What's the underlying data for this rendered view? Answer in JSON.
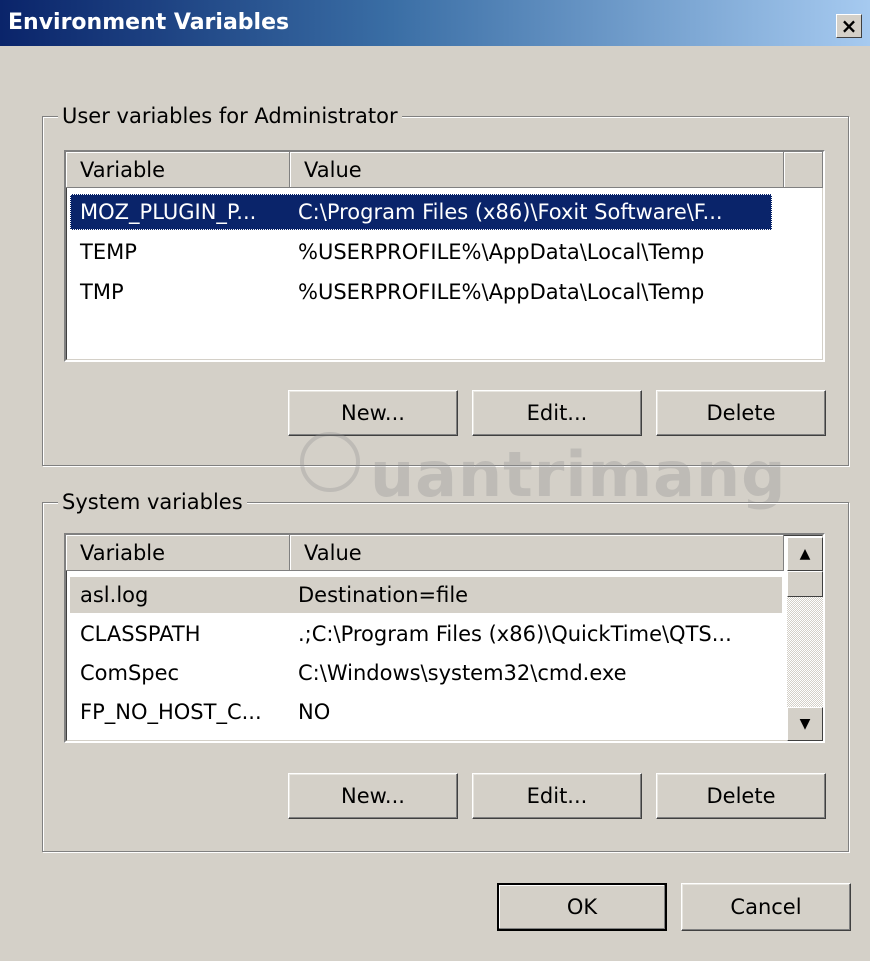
{
  "window": {
    "title": "Environment Variables",
    "close_label": "×"
  },
  "user_group": {
    "label": "User variables for Administrator",
    "columns": [
      "Variable",
      "Value"
    ],
    "rows": [
      {
        "variable": "MOZ_PLUGIN_P...",
        "value": "C:\\Program Files (x86)\\Foxit Software\\F..."
      },
      {
        "variable": "TEMP",
        "value": "%USERPROFILE%\\AppData\\Local\\Temp"
      },
      {
        "variable": "TMP",
        "value": "%USERPROFILE%\\AppData\\Local\\Temp"
      }
    ],
    "buttons": {
      "new": "New...",
      "edit": "Edit...",
      "delete": "Delete"
    }
  },
  "system_group": {
    "label": "System variables",
    "columns": [
      "Variable",
      "Value"
    ],
    "rows": [
      {
        "variable": "asl.log",
        "value": "Destination=file"
      },
      {
        "variable": "CLASSPATH",
        "value": ".;C:\\Program Files (x86)\\QuickTime\\QTS..."
      },
      {
        "variable": "ComSpec",
        "value": "C:\\Windows\\system32\\cmd.exe"
      },
      {
        "variable": "FP_NO_HOST_C...",
        "value": "NO"
      }
    ],
    "buttons": {
      "new": "New...",
      "edit": "Edit...",
      "delete": "Delete"
    },
    "scroll_up": "▲",
    "scroll_down": "▼"
  },
  "footer": {
    "ok": "OK",
    "cancel": "Cancel"
  },
  "watermark": "uantrimang",
  "colors": {
    "selection": "#0a246a",
    "face": "#d4d0c8"
  }
}
